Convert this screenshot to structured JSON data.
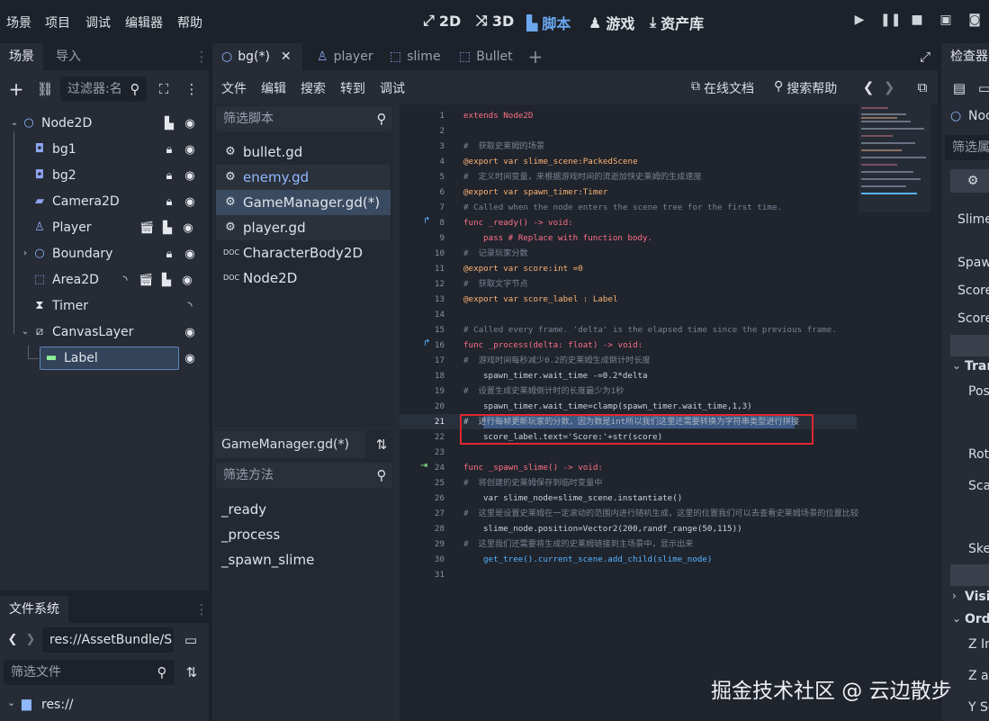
{
  "menu": [
    "场景",
    "项目",
    "调试",
    "编辑器",
    "帮助"
  ],
  "workspaces": [
    {
      "label": "2D",
      "icon": "2d-icon"
    },
    {
      "label": "3D",
      "icon": "3d-icon"
    },
    {
      "label": "脚本",
      "icon": "script-icon",
      "active": true
    },
    {
      "label": "游戏",
      "icon": "game-icon"
    },
    {
      "label": "资产库",
      "icon": "asset-lib-icon"
    }
  ],
  "scene_dock": {
    "tabs": [
      "场景",
      "导入"
    ],
    "filter_placeholder": "过滤器:名",
    "nodes": [
      {
        "label": "Node2D"
      },
      {
        "label": "bg1"
      },
      {
        "label": "bg2"
      },
      {
        "label": "Camera2D"
      },
      {
        "label": "Player"
      },
      {
        "label": "Boundary"
      },
      {
        "label": "Area2D"
      },
      {
        "label": "Timer"
      },
      {
        "label": "CanvasLayer"
      },
      {
        "label": "Label"
      }
    ]
  },
  "filesystem": {
    "title": "文件系统",
    "path": "res://AssetBundle/S",
    "filter_placeholder": "筛选文件",
    "root": "res://"
  },
  "editor_tabs": [
    {
      "label": "bg(*)",
      "active": true
    },
    {
      "label": "player"
    },
    {
      "label": "slime"
    },
    {
      "label": "Bullet"
    }
  ],
  "script_menu": [
    "文件",
    "编辑",
    "搜索",
    "转到",
    "调试"
  ],
  "script_toolbar": {
    "online_docs": "在线文档",
    "search_help": "搜索帮助"
  },
  "script_filter_placeholder": "筛选脚本",
  "scripts": [
    {
      "label": "bullet.gd"
    },
    {
      "label": "enemy.gd"
    },
    {
      "label": "GameManager.gd(*)"
    },
    {
      "label": "player.gd"
    },
    {
      "label": "CharacterBody2D"
    },
    {
      "label": "Node2D"
    }
  ],
  "current_script": "GameManager.gd(*)",
  "method_filter_placeholder": "筛选方法",
  "methods": [
    "_ready",
    "_process",
    "_spawn_slime"
  ],
  "code": {
    "l1": "extends Node2D",
    "l3": "#  获取史莱姆的场景",
    "l4": "@export var slime_scene:PackedScene",
    "l5": "#  定义时间变量，来根据游戏时间的流逝加快史莱姆的生成速度",
    "l6": "@export var spawn_timer:Timer",
    "l7": "# Called when the node enters the scene tree for the first time.",
    "l8": "func _ready() -> void:",
    "l9": "pass # Replace with function body.",
    "l10": "#  记录玩家分数",
    "l11": "@export var score:int =0",
    "l12": "#  获取文字节点",
    "l13": "@export var score_label : Label",
    "l15": "# Called every frame. 'delta' is the elapsed time since the previous frame.",
    "l16": "func _process(delta: float) -> void:",
    "l17": "#  游戏时间每秒减少0.2的史莱姆生成倒计时长度",
    "l18": "spawn_timer.wait_time -=0.2*delta",
    "l19": "#  设置生成史莱姆倒计时的长度最少为1秒",
    "l20": "spawn_timer.wait_time=clamp(spawn_timer.wait_time,1,3)",
    "l21": "#  进行每帧更新玩家的分数，因为数是int所以我们这里还需要转换为字符串类型进行拼接",
    "l22": "score_label.text='Score:'+str(score)",
    "l24": "func _spawn_slime() -> void:",
    "l25": "#  将创建的史莱姆保存到临时变量中",
    "l26": "var slime_node=slime_scene.instantiate()",
    "l27": "#  这里是设置史莱姆在一定滚动的范围内进行随机生成，这里的位置我们可以去查看史莱姆场景的位置比较",
    "l28": "slime_node.position=Vector2(200,randf_range(50,115))",
    "l29": "#  这里我们还需要将生成的史莱姆链接到主场景中，显示出来",
    "l30": "get_tree().current_scene.add_child(slime_node)"
  },
  "line_numbers": [
    "1",
    "2",
    "3",
    "4",
    "5",
    "6",
    "7",
    "8",
    "9",
    "10",
    "11",
    "12",
    "13",
    "14",
    "15",
    "16",
    "17",
    "18",
    "19",
    "20",
    "21",
    "22",
    "23",
    "24",
    "25",
    "26",
    "27",
    "28",
    "29",
    "30",
    "31"
  ],
  "inspector": {
    "tab": "检查器",
    "node_name": "Noc",
    "filter_placeholder": "筛选属",
    "props": [
      "Slime",
      "Spaw",
      "Score",
      "Score",
      "Tran",
      "Pos",
      "Rot",
      "Sca",
      "Ske",
      "Visil",
      "Ord",
      "Z In",
      "Z as",
      "Y So"
    ]
  },
  "watermark": "掘金技术社区 @ 云边散步",
  "colors": {
    "accent": "#6ba8f0",
    "highlight_box": "#e0282e",
    "bg": "#1d2129",
    "panel": "#262b35"
  }
}
